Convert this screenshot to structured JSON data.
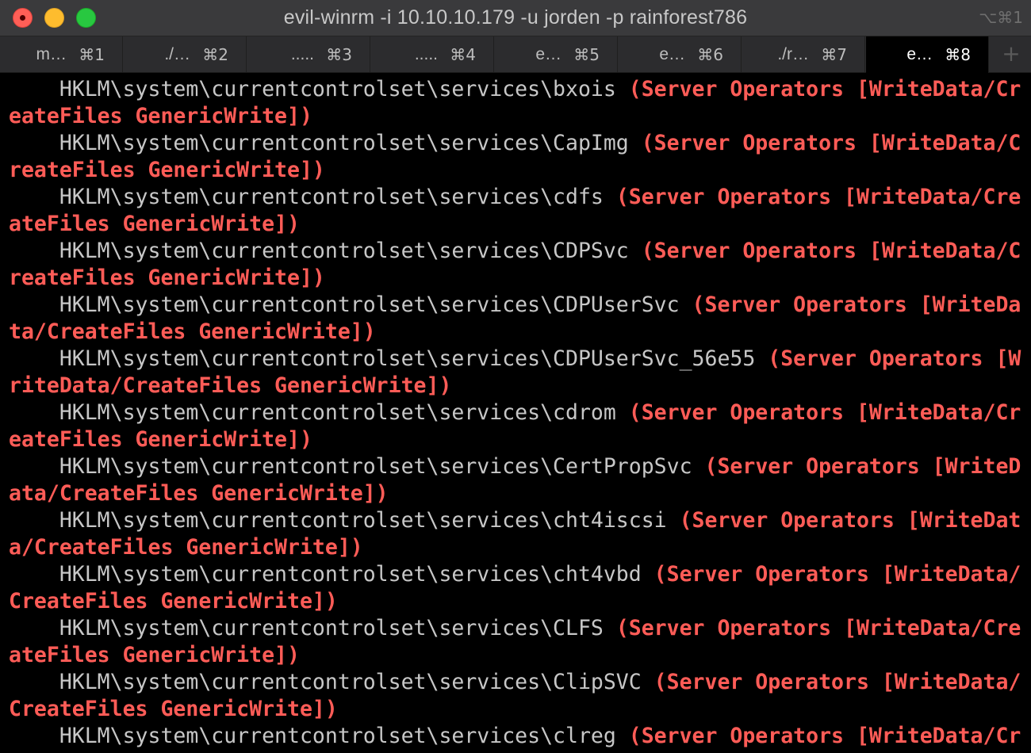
{
  "window": {
    "title": "evil-winrm -i 10.10.10.179 -u jorden -p rainforest786",
    "title_shortcut": "⌥⌘1"
  },
  "tabs": [
    {
      "label": "m…",
      "shortcut": "⌘1"
    },
    {
      "label": "./…",
      "shortcut": "⌘2"
    },
    {
      "label": ".....",
      "shortcut": "⌘3"
    },
    {
      "label": ".....",
      "shortcut": "⌘4"
    },
    {
      "label": "e…",
      "shortcut": "⌘5"
    },
    {
      "label": "e…",
      "shortcut": "⌘6"
    },
    {
      "label": "./r…",
      "shortcut": "⌘7"
    },
    {
      "label": "e…",
      "shortcut": "⌘8",
      "active": true
    }
  ],
  "new_tab_label": "+",
  "colors": {
    "path_text": "#c7c7c7",
    "permission_text": "#ff5c57",
    "background": "#000000"
  },
  "terminal_lines": [
    {
      "path": "    HKLM\\system\\currentcontrolset\\services\\bxois ",
      "perm": "(Server Operators [WriteData/Cr"
    },
    {
      "path": "",
      "perm": "eateFiles GenericWrite])"
    },
    {
      "path": "    HKLM\\system\\currentcontrolset\\services\\CapImg ",
      "perm": "(Server Operators [WriteData/C"
    },
    {
      "path": "",
      "perm": "reateFiles GenericWrite])"
    },
    {
      "path": "    HKLM\\system\\currentcontrolset\\services\\cdfs ",
      "perm": "(Server Operators [WriteData/Cre"
    },
    {
      "path": "",
      "perm": "ateFiles GenericWrite])"
    },
    {
      "path": "    HKLM\\system\\currentcontrolset\\services\\CDPSvc ",
      "perm": "(Server Operators [WriteData/C"
    },
    {
      "path": "",
      "perm": "reateFiles GenericWrite])"
    },
    {
      "path": "    HKLM\\system\\currentcontrolset\\services\\CDPUserSvc ",
      "perm": "(Server Operators [WriteDa"
    },
    {
      "path": "",
      "perm": "ta/CreateFiles GenericWrite])"
    },
    {
      "path": "    HKLM\\system\\currentcontrolset\\services\\CDPUserSvc_56e55 ",
      "perm": "(Server Operators [W"
    },
    {
      "path": "",
      "perm": "riteData/CreateFiles GenericWrite])"
    },
    {
      "path": "    HKLM\\system\\currentcontrolset\\services\\cdrom ",
      "perm": "(Server Operators [WriteData/Cr"
    },
    {
      "path": "",
      "perm": "eateFiles GenericWrite])"
    },
    {
      "path": "    HKLM\\system\\currentcontrolset\\services\\CertPropSvc ",
      "perm": "(Server Operators [WriteD"
    },
    {
      "path": "",
      "perm": "ata/CreateFiles GenericWrite])"
    },
    {
      "path": "    HKLM\\system\\currentcontrolset\\services\\cht4iscsi ",
      "perm": "(Server Operators [WriteDat"
    },
    {
      "path": "",
      "perm": "a/CreateFiles GenericWrite])"
    },
    {
      "path": "    HKLM\\system\\currentcontrolset\\services\\cht4vbd ",
      "perm": "(Server Operators [WriteData/"
    },
    {
      "path": "",
      "perm": "CreateFiles GenericWrite])"
    },
    {
      "path": "    HKLM\\system\\currentcontrolset\\services\\CLFS ",
      "perm": "(Server Operators [WriteData/Cre"
    },
    {
      "path": "",
      "perm": "ateFiles GenericWrite])"
    },
    {
      "path": "    HKLM\\system\\currentcontrolset\\services\\ClipSVC ",
      "perm": "(Server Operators [WriteData/"
    },
    {
      "path": "",
      "perm": "CreateFiles GenericWrite])"
    },
    {
      "path": "    HKLM\\system\\currentcontrolset\\services\\clreg ",
      "perm": "(Server Operators [WriteData/Cr"
    }
  ]
}
